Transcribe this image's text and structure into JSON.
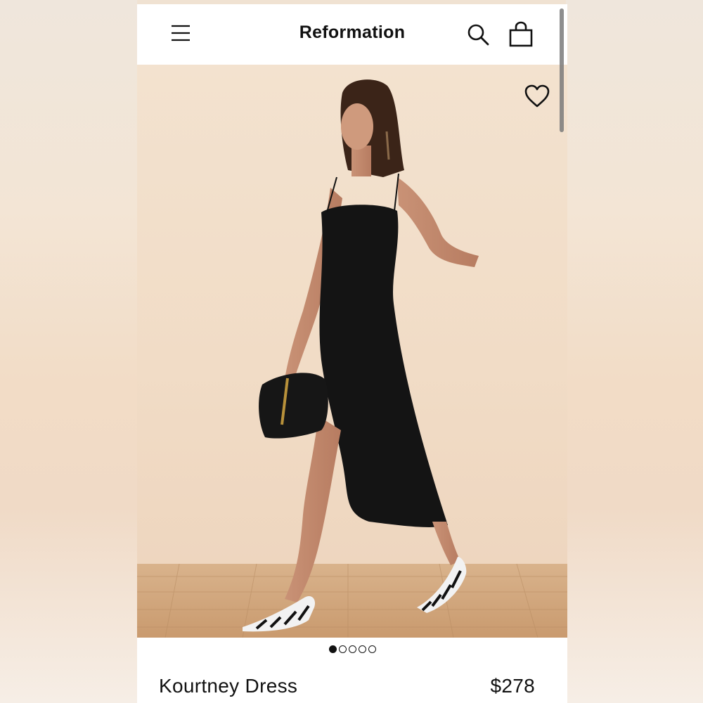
{
  "header": {
    "brand": "Reformation",
    "icons": {
      "menu": "hamburger-menu-icon",
      "search": "search-icon",
      "cart": "shopping-bag-icon"
    }
  },
  "gallery": {
    "image_description_icon": "product-photo",
    "favorite_icon": "heart-outline-icon",
    "total_images": 5,
    "active_index": 0
  },
  "product": {
    "name": "Kourtney Dress",
    "price": "$278"
  },
  "colors": {
    "background": "#ffffff",
    "text": "#111111",
    "photo_wall": "#f2dfcb",
    "floor": "#d8b089"
  }
}
